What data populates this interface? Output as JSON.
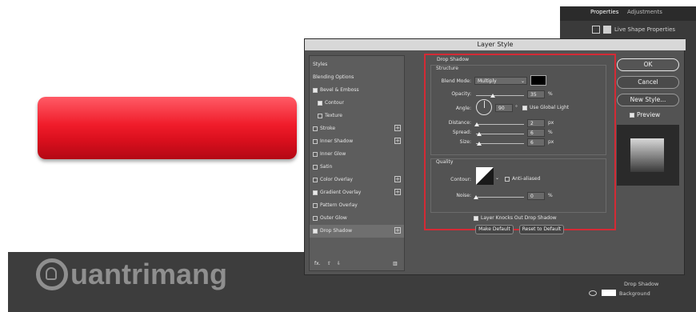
{
  "right_panel": {
    "tabs": [
      "Properties",
      "Adjustments"
    ],
    "shape_label": "Live Shape Properties",
    "layers": [
      "Drop Shadow",
      "Background"
    ]
  },
  "watermark": {
    "text": "uantrimang",
    "letter": "Q"
  },
  "dialog": {
    "title": "Layer Style",
    "styles": [
      {
        "label": "Styles",
        "checkbox": false,
        "checked": false,
        "plus": false
      },
      {
        "label": "Blending Options",
        "checkbox": false,
        "checked": false,
        "plus": false
      },
      {
        "label": "Bevel & Emboss",
        "checkbox": true,
        "checked": true,
        "plus": false
      },
      {
        "label": "Contour",
        "checkbox": true,
        "checked": true,
        "plus": false
      },
      {
        "label": "Texture",
        "checkbox": true,
        "checked": false,
        "plus": false
      },
      {
        "label": "Stroke",
        "checkbox": true,
        "checked": false,
        "plus": true
      },
      {
        "label": "Inner Shadow",
        "checkbox": true,
        "checked": false,
        "plus": true
      },
      {
        "label": "Inner Glow",
        "checkbox": true,
        "checked": false,
        "plus": false
      },
      {
        "label": "Satin",
        "checkbox": true,
        "checked": false,
        "plus": false
      },
      {
        "label": "Color Overlay",
        "checkbox": true,
        "checked": false,
        "plus": true
      },
      {
        "label": "Gradient Overlay",
        "checkbox": true,
        "checked": true,
        "plus": true
      },
      {
        "label": "Pattern Overlay",
        "checkbox": true,
        "checked": false,
        "plus": false
      },
      {
        "label": "Outer Glow",
        "checkbox": true,
        "checked": false,
        "plus": false
      },
      {
        "label": "Drop Shadow",
        "checkbox": true,
        "checked": true,
        "plus": true
      }
    ],
    "fx_label": "fx.",
    "drop_shadow": {
      "heading": "Drop Shadow",
      "structure": "Structure",
      "blend_mode_label": "Blend Mode:",
      "blend_mode": "Multiply",
      "shadow_color": "#000000",
      "opacity_label": "Opacity:",
      "opacity": "35",
      "opacity_level": 0.35,
      "angle_label": "Angle:",
      "angle": "90",
      "use_global_light": "Use Global Light",
      "distance_label": "Distance:",
      "distance": "2",
      "distance_level": 0.02,
      "spread_label": "Spread:",
      "spread": "6",
      "spread_level": 0.06,
      "size_label": "Size:",
      "size": "6",
      "size_level": 0.06,
      "quality": "Quality",
      "contour_label": "Contour:",
      "anti_aliased": "Anti-aliased",
      "noise_label": "Noise:",
      "noise": "0",
      "noise_level": 0,
      "knocks_out": "Layer Knocks Out Drop Shadow",
      "make_default": "Make Default",
      "reset_default": "Reset to Default",
      "unit_px": "px",
      "unit_pct": "%",
      "unit_deg": "°"
    },
    "buttons": {
      "ok": "OK",
      "cancel": "Cancel",
      "new_style": "New Style...",
      "preview": "Preview"
    }
  },
  "colors": {
    "accent_red": "#d42a35",
    "button_red": "#f01c2a"
  }
}
